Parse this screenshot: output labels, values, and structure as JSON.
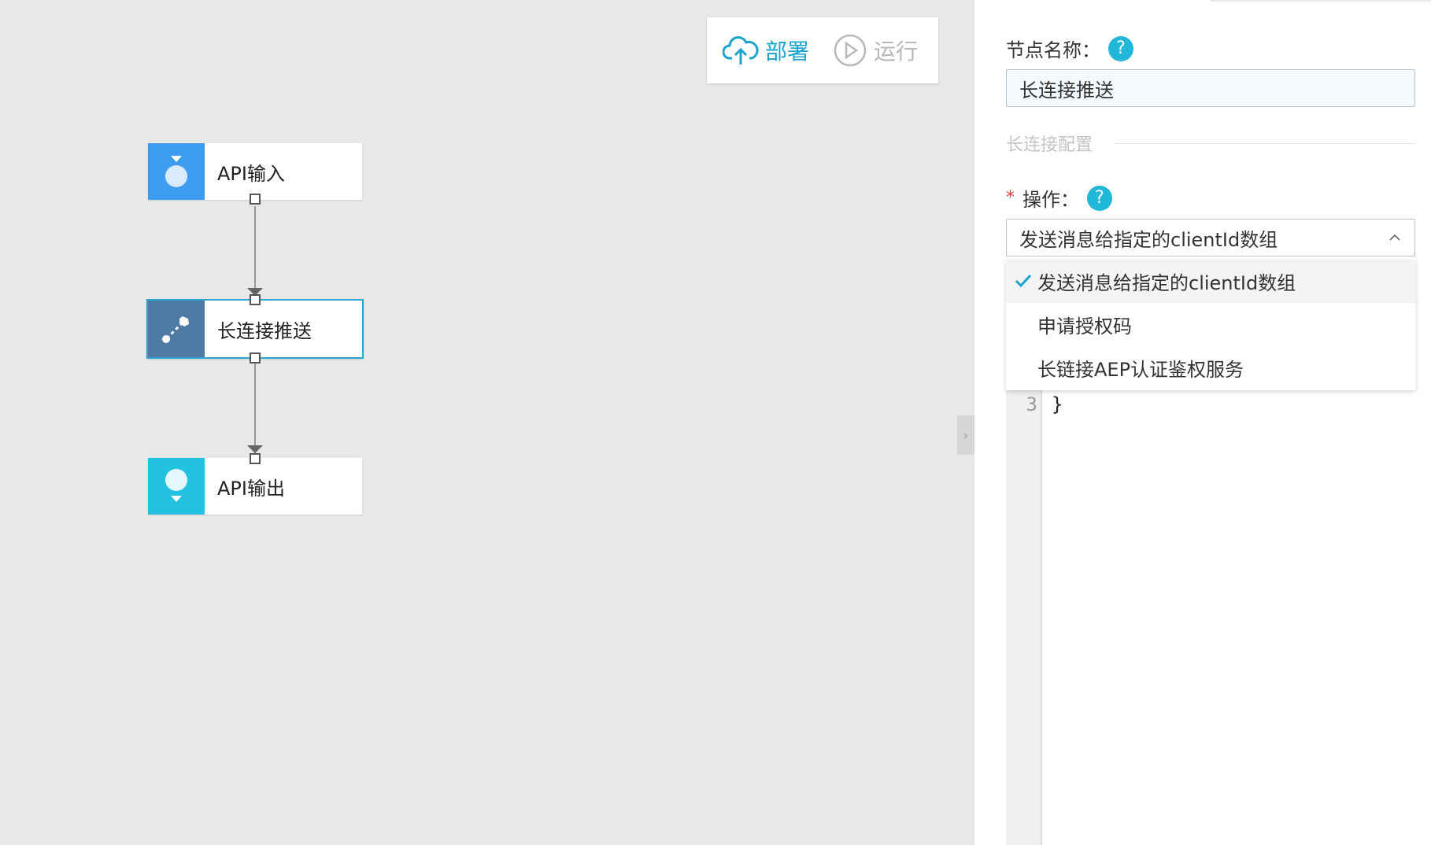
{
  "toolbar": {
    "deploy_label": "部署",
    "run_label": "运行"
  },
  "nodes": [
    {
      "label": "API输入",
      "icon": "api-input-icon",
      "color": "#3c9df0"
    },
    {
      "label": "长连接推送",
      "icon": "connection-push-icon",
      "color": "#4f7aa3",
      "selected": true
    },
    {
      "label": "API输出",
      "icon": "api-output-icon",
      "color": "#22c2e0"
    }
  ],
  "panel": {
    "node_name_label": "节点名称：",
    "node_name_value": "长连接推送",
    "section_title": "长连接配置",
    "operation_label": "操作：",
    "operation_selected": "发送消息给指定的clientId数组",
    "operation_options": [
      "发送消息给指定的clientId数组",
      "申请授权码",
      "长链接AEP认证鉴权服务"
    ],
    "code": {
      "line_number": "3",
      "line_text": "}"
    }
  },
  "colors": {
    "accent": "#1aa3cc",
    "help": "#20b7d9",
    "required": "#e0403a"
  }
}
